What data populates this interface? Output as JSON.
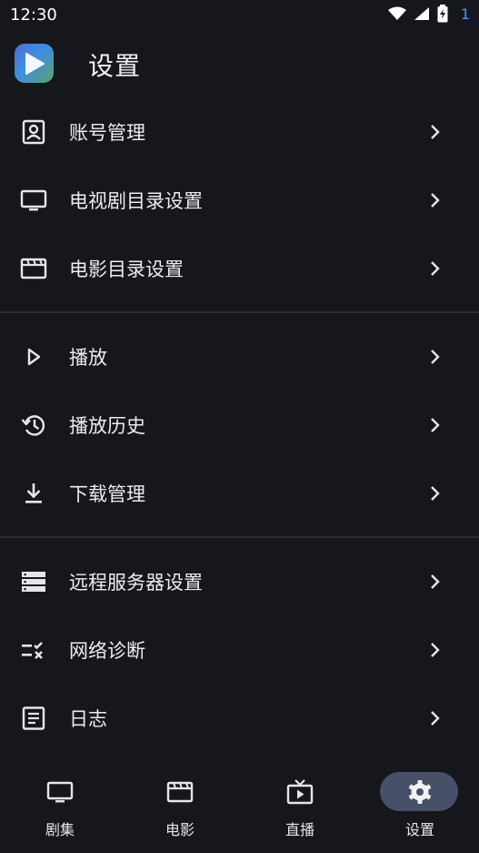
{
  "status_bar": {
    "time": "12:30",
    "notification_count": "1"
  },
  "header": {
    "title": "设置"
  },
  "menu": {
    "items": [
      {
        "label": "账号管理",
        "icon": "account-box-icon"
      },
      {
        "label": "电视剧目录设置",
        "icon": "tv-icon"
      },
      {
        "label": "电影目录设置",
        "icon": "movie-icon"
      },
      {
        "label": "播放",
        "icon": "play-icon"
      },
      {
        "label": "播放历史",
        "icon": "history-icon"
      },
      {
        "label": "下载管理",
        "icon": "download-icon"
      },
      {
        "label": "远程服务器设置",
        "icon": "server-icon"
      },
      {
        "label": "网络诊断",
        "icon": "rule-icon"
      },
      {
        "label": "日志",
        "icon": "log-icon"
      }
    ]
  },
  "bottom_nav": {
    "tabs": [
      {
        "label": "剧集",
        "icon": "tv-icon"
      },
      {
        "label": "电影",
        "icon": "movie-icon"
      },
      {
        "label": "直播",
        "icon": "live-tv-icon"
      },
      {
        "label": "设置",
        "icon": "gear-icon",
        "active": true
      }
    ]
  },
  "colors": {
    "background": "#16171d",
    "active_tab_pill": "#465066",
    "notification_accent": "#3aa0ff"
  }
}
